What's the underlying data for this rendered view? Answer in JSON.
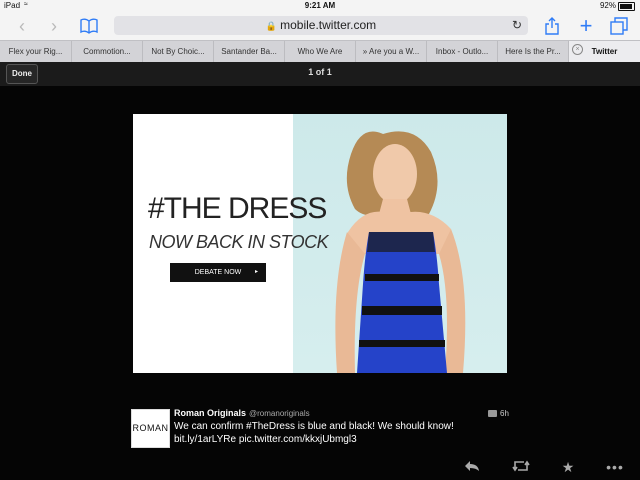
{
  "status_bar": {
    "device": "iPad",
    "time": "9:21 AM",
    "battery": "92%"
  },
  "toolbar": {
    "url": "mobile.twitter.com"
  },
  "tabs": [
    {
      "label": "Flex your Rig..."
    },
    {
      "label": "Commotion..."
    },
    {
      "label": "Not By Choic..."
    },
    {
      "label": "Santander Ba..."
    },
    {
      "label": "Who We Are"
    },
    {
      "label": "» Are you a W..."
    },
    {
      "label": "Inbox - Outlo..."
    },
    {
      "label": "Here Is the Pr..."
    },
    {
      "label": "Twitter"
    }
  ],
  "viewer": {
    "done_label": "Done",
    "pager": "1 of 1"
  },
  "image": {
    "headline": "#THE DRESS",
    "subline": "NOW BACK IN STOCK",
    "button": "DEBATE NOW"
  },
  "tweet": {
    "avatar_text": "ROMAN",
    "author": "Roman Originals",
    "handle": "@romanoriginals",
    "time": "6h",
    "line1": "We can confirm #TheDress is blue and black! We should know!",
    "line2": "bit.ly/1arLYRe pic.twitter.com/kkxjUbmgl3"
  },
  "icons": [
    "back-icon",
    "forward-icon",
    "bookmarks-icon",
    "lock-icon",
    "reload-icon",
    "share-icon",
    "new-tab-icon",
    "tabs-icon",
    "reply-icon",
    "retweet-icon",
    "favorite-icon",
    "more-icon"
  ]
}
